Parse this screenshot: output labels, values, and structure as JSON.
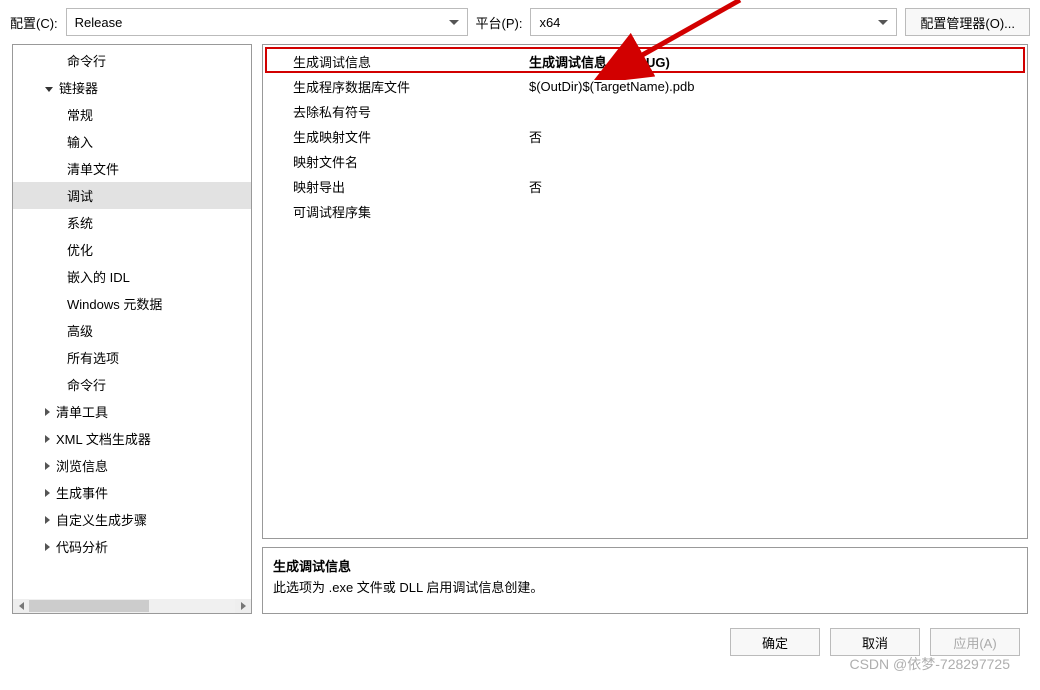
{
  "topbar": {
    "config_label": "配置(C):",
    "config_value": "Release",
    "platform_label": "平台(P):",
    "platform_value": "x64",
    "config_mgr": "配置管理器(O)..."
  },
  "tree": {
    "items": [
      {
        "label": "命令行",
        "level": 2,
        "exp": null,
        "selected": false
      },
      {
        "label": "链接器",
        "level": 1,
        "exp": "open",
        "selected": false
      },
      {
        "label": "常规",
        "level": 2,
        "exp": null,
        "selected": false
      },
      {
        "label": "输入",
        "level": 2,
        "exp": null,
        "selected": false
      },
      {
        "label": "清单文件",
        "level": 2,
        "exp": null,
        "selected": false
      },
      {
        "label": "调试",
        "level": 2,
        "exp": null,
        "selected": true
      },
      {
        "label": "系统",
        "level": 2,
        "exp": null,
        "selected": false
      },
      {
        "label": "优化",
        "level": 2,
        "exp": null,
        "selected": false
      },
      {
        "label": "嵌入的 IDL",
        "level": 2,
        "exp": null,
        "selected": false
      },
      {
        "label": "Windows 元数据",
        "level": 2,
        "exp": null,
        "selected": false
      },
      {
        "label": "高级",
        "level": 2,
        "exp": null,
        "selected": false
      },
      {
        "label": "所有选项",
        "level": 2,
        "exp": null,
        "selected": false
      },
      {
        "label": "命令行",
        "level": 2,
        "exp": null,
        "selected": false
      },
      {
        "label": "清单工具",
        "level": 1,
        "exp": "closed",
        "selected": false
      },
      {
        "label": "XML 文档生成器",
        "level": 1,
        "exp": "closed",
        "selected": false
      },
      {
        "label": "浏览信息",
        "level": 1,
        "exp": "closed",
        "selected": false
      },
      {
        "label": "生成事件",
        "level": 1,
        "exp": "closed",
        "selected": false
      },
      {
        "label": "自定义生成步骤",
        "level": 1,
        "exp": "closed",
        "selected": false
      },
      {
        "label": "代码分析",
        "level": 1,
        "exp": "closed",
        "selected": false
      }
    ]
  },
  "props": {
    "rows": [
      {
        "key": "生成调试信息",
        "val": "生成调试信息 (/DEBUG)",
        "bold": true
      },
      {
        "key": "生成程序数据库文件",
        "val": "$(OutDir)$(TargetName).pdb",
        "bold": false
      },
      {
        "key": "去除私有符号",
        "val": "",
        "bold": false
      },
      {
        "key": "生成映射文件",
        "val": "否",
        "bold": false
      },
      {
        "key": "映射文件名",
        "val": "",
        "bold": false
      },
      {
        "key": "映射导出",
        "val": "否",
        "bold": false
      },
      {
        "key": "可调试程序集",
        "val": "",
        "bold": false
      }
    ]
  },
  "desc": {
    "title": "生成调试信息",
    "text": "此选项为 .exe 文件或 DLL 启用调试信息创建。"
  },
  "buttons": {
    "ok": "确定",
    "cancel": "取消",
    "apply": "应用(A)"
  },
  "watermark": "CSDN @依梦-728297725"
}
